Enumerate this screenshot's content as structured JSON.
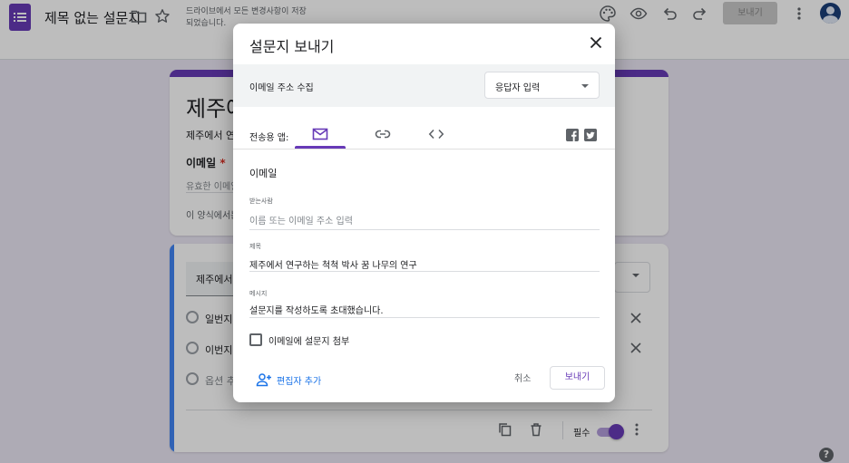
{
  "app": {
    "doc_title": "제목 없는 설문지",
    "save_note": "드라이브에서 모든 변경사항이 저장되었습니다.",
    "send_button": "보내기",
    "colors": {
      "accent": "#673ab7",
      "background": "#ebe7f4",
      "link": "#1a73e8"
    },
    "icons": [
      "forms-logo-icon",
      "folder-icon",
      "star-icon",
      "palette-icon",
      "preview-eye-icon",
      "undo-icon",
      "redo-icon",
      "more-vert-icon",
      "account-avatar-icon"
    ]
  },
  "form_background": {
    "title": "제주에",
    "description": "제주에서 연구",
    "email_label": "이메일",
    "required_mark": "*",
    "email_hint": "유효한 이메일",
    "notice": "이 양식에서는",
    "question_text": "제주에서",
    "options": [
      "일번지",
      "이번지",
      "옵션 추"
    ],
    "required_label": "필수",
    "help_glyph": "?"
  },
  "dialog": {
    "title": "설문지 보내기",
    "collect_email_label": "이메일 주소 수집",
    "collect_email_value": "응답자 입력",
    "send_via_label": "전송용 앱:",
    "tabs": [
      {
        "id": "email",
        "icon": "mail-icon",
        "active": true
      },
      {
        "id": "link",
        "icon": "link-icon",
        "active": false
      },
      {
        "id": "embed",
        "icon": "code-icon",
        "active": false
      }
    ],
    "share_icons": [
      "facebook-icon",
      "twitter-icon"
    ],
    "section_heading": "이메일",
    "to_label": "받는사람",
    "to_placeholder": "이름 또는 이메일 주소 입력",
    "subject_label": "제목",
    "subject_value": "제주에서 연구하는 척척 박사 꿈 나무의 연구",
    "message_label": "메시지",
    "message_value": "설문지를 작성하도록 초대했습니다.",
    "include_form_label": "이메일에 설문지 첨부",
    "add_editors_label": "편집자 추가",
    "cancel_label": "취소",
    "send_label": "보내기"
  }
}
